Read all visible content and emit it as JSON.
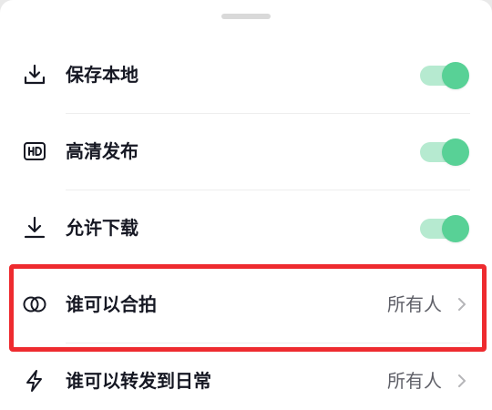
{
  "sheet": {
    "items": [
      {
        "label": "保存本地",
        "icon": "download-icon",
        "control": "toggle",
        "on": true
      },
      {
        "label": "高清发布",
        "icon": "hd-icon",
        "control": "toggle",
        "on": true
      },
      {
        "label": "允许下载",
        "icon": "download-arrow-icon",
        "control": "toggle",
        "on": true
      },
      {
        "label": "谁可以合拍",
        "icon": "duet-icon",
        "control": "value",
        "value": "所有人"
      },
      {
        "label": "谁可以转发到日常",
        "icon": "lightning-icon",
        "control": "value",
        "value": "所有人"
      }
    ]
  },
  "colors": {
    "toggle_track": "#b6ead0",
    "toggle_knob": "#58d196",
    "highlight_border": "#ee2b2f"
  }
}
